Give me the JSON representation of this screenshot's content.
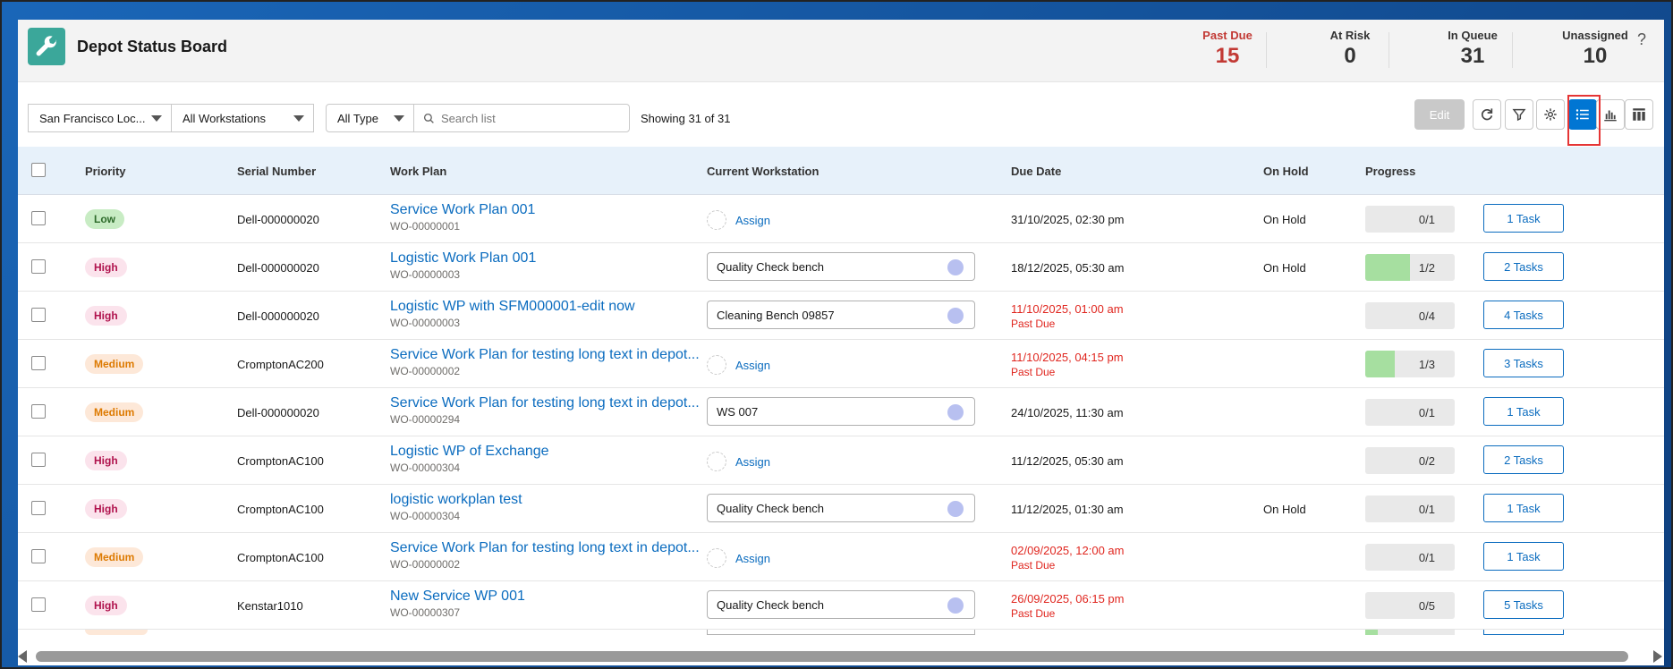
{
  "header": {
    "title": "Depot Status Board",
    "metrics": [
      {
        "label": "Past Due",
        "value": "15",
        "danger": true
      },
      {
        "label": "At Risk",
        "value": "0",
        "danger": false
      },
      {
        "label": "In Queue",
        "value": "31",
        "danger": false
      },
      {
        "label": "Unassigned",
        "value": "10",
        "danger": false
      }
    ],
    "help": "?"
  },
  "toolbar": {
    "location": "San Francisco Loc...",
    "workstations": "All Workstations",
    "type": "All Type",
    "search_placeholder": "Search list",
    "showing": "Showing 31 of 31",
    "edit_label": "Edit"
  },
  "columns": {
    "priority": "Priority",
    "serial": "Serial Number",
    "work_plan": "Work Plan",
    "workstation": "Current Workstation",
    "due_date": "Due Date",
    "on_hold": "On Hold",
    "progress": "Progress"
  },
  "rows": [
    {
      "priority": "Low",
      "level": "low",
      "serial": "Dell-000000020",
      "plan": "Service Work Plan 001",
      "wo": "WO-00000001",
      "ws": "",
      "assign": "Assign",
      "due": "31/10/2025, 02:30 pm",
      "late": false,
      "hold": "On Hold",
      "progress": "0/1",
      "done": 0,
      "total": 1,
      "tasks": "1 Task"
    },
    {
      "priority": "High",
      "level": "high",
      "serial": "Dell-000000020",
      "plan": "Logistic Work Plan 001",
      "wo": "WO-00000003",
      "ws": "Quality Check bench",
      "assign": "",
      "due": "18/12/2025, 05:30 am",
      "late": false,
      "hold": "On Hold",
      "progress": "1/2",
      "done": 1,
      "total": 2,
      "tasks": "2 Tasks"
    },
    {
      "priority": "High",
      "level": "high",
      "serial": "Dell-000000020",
      "plan": "Logistic WP with SFM000001-edit now",
      "wo": "WO-00000003",
      "ws": "Cleaning Bench 09857",
      "assign": "",
      "due": "11/10/2025, 01:00 am",
      "late": true,
      "late_label": "Past Due",
      "hold": "",
      "progress": "0/4",
      "done": 0,
      "total": 4,
      "tasks": "4 Tasks"
    },
    {
      "priority": "Medium",
      "level": "medium",
      "serial": "CromptonAC200",
      "plan": "Service Work Plan for testing long text in depot...",
      "wo": "WO-00000002",
      "ws": "",
      "assign": "Assign",
      "due": "11/10/2025, 04:15 pm",
      "late": true,
      "late_label": "Past Due",
      "hold": "",
      "progress": "1/3",
      "done": 1,
      "total": 3,
      "tasks": "3 Tasks"
    },
    {
      "priority": "Medium",
      "level": "medium",
      "serial": "Dell-000000020",
      "plan": "Service Work Plan for testing long text in depot...",
      "wo": "WO-00000294",
      "ws": "WS 007",
      "assign": "",
      "due": "24/10/2025, 11:30 am",
      "late": false,
      "hold": "",
      "progress": "0/1",
      "done": 0,
      "total": 1,
      "tasks": "1 Task"
    },
    {
      "priority": "High",
      "level": "high",
      "serial": "CromptonAC100",
      "plan": "Logistic WP of Exchange",
      "wo": "WO-00000304",
      "ws": "",
      "assign": "Assign",
      "due": "11/12/2025, 05:30 am",
      "late": false,
      "hold": "",
      "progress": "0/2",
      "done": 0,
      "total": 2,
      "tasks": "2 Tasks"
    },
    {
      "priority": "High",
      "level": "high",
      "serial": "CromptonAC100",
      "plan": "logistic workplan test",
      "wo": "WO-00000304",
      "ws": "Quality Check bench",
      "assign": "",
      "due": "11/12/2025, 01:30 am",
      "late": false,
      "hold": "On Hold",
      "progress": "0/1",
      "done": 0,
      "total": 1,
      "tasks": "1 Task"
    },
    {
      "priority": "Medium",
      "level": "medium",
      "serial": "CromptonAC100",
      "plan": "Service Work Plan for testing long text in depot...",
      "wo": "WO-00000002",
      "ws": "",
      "assign": "Assign",
      "due": "02/09/2025, 12:00 am",
      "late": true,
      "late_label": "Past Due",
      "hold": "",
      "progress": "0/1",
      "done": 0,
      "total": 1,
      "tasks": "1 Task"
    },
    {
      "priority": "High",
      "level": "high",
      "serial": "Kenstar1010",
      "plan": "New Service WP 001",
      "wo": "WO-00000307",
      "ws": "Quality Check bench",
      "assign": "",
      "due": "26/09/2025, 06:15 pm",
      "late": true,
      "late_label": "Past Due",
      "hold": "",
      "progress": "0/5",
      "done": 0,
      "total": 5,
      "tasks": "5 Tasks"
    }
  ]
}
